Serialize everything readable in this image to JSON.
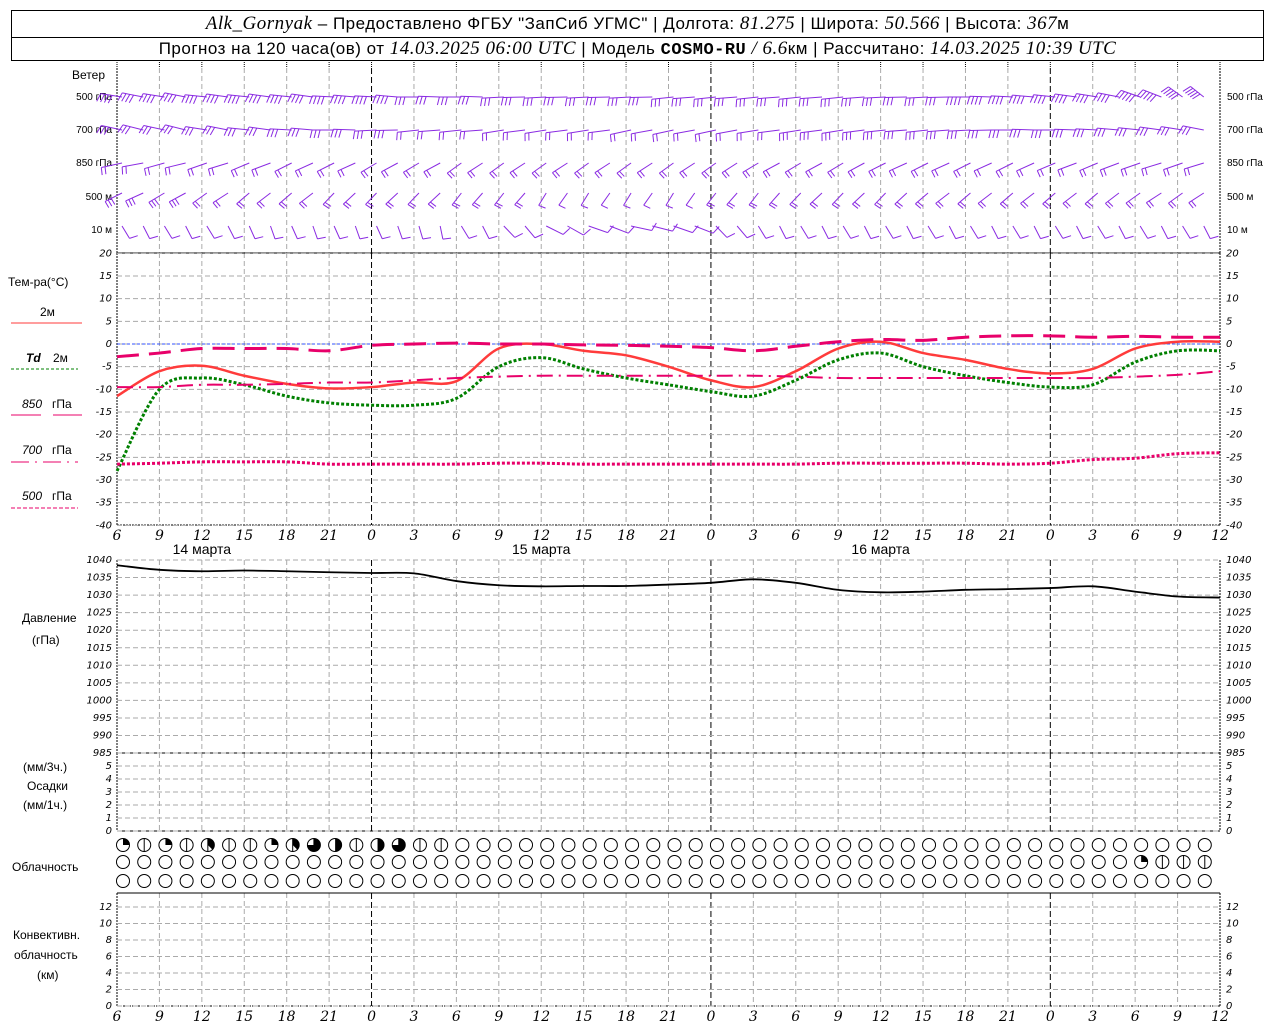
{
  "header": {
    "station": "Alk_Gornyak",
    "provided_by": " – Предоставлено ФГБУ \"ЗапСиб УГМС\" | Долгота: ",
    "longitude": "81.275",
    "lat_label": " | Широта: ",
    "latitude": "50.566",
    "alt_label": " | Высота: ",
    "altitude": "367",
    "alt_unit": "м",
    "forecast_prefix": "Прогноз на 120 часа(ов) от ",
    "forecast_start": "14.03.2025 06:00 UTC",
    "model_label": "  | Модель ",
    "model": "COSMO-RU",
    "resolution": " / 6.6",
    "res_unit": "км",
    "calc_label": " | Рассчитано: ",
    "calc_time": "14.03.2025 10:39 UTC"
  },
  "labels": {
    "wind": "Ветер",
    "wind_levels": [
      "500 гПа",
      "700 гПа",
      "850 гПа",
      "500  м",
      "10  м"
    ],
    "temp_title": "Тем-ра(°С)",
    "t2m": "2м",
    "td": "Td",
    "td2m": "2м",
    "l850": "850",
    "l700": "700",
    "l500": "500",
    "hpa": "гПа",
    "pressure": "Давление",
    "pressure_unit": "(гПа)",
    "precip_3h": "(мм/3ч.)",
    "precip": "Осадки",
    "precip_1h": "(мм/1ч.)",
    "clouds": "Облачность",
    "conv1": "Конвективн.",
    "conv2": "облачность",
    "conv3": "(км)"
  },
  "colors": {
    "wind": "#8a2be2",
    "t2m": "#ff3b3b",
    "td": "#008000",
    "t850": "#e8006a",
    "t700": "#e8006a",
    "t500": "#e8006a",
    "zero": "#3050ff",
    "grid": "#aaaaaa"
  },
  "chart_data": [
    {
      "type": "line",
      "title": "Тем-ра(°С)",
      "x_ticks": [
        "6",
        "9",
        "12",
        "15",
        "18",
        "21",
        "0",
        "3",
        "6",
        "9",
        "12",
        "15",
        "18",
        "21",
        "0",
        "3",
        "6",
        "9",
        "12",
        "15",
        "18",
        "21",
        "0",
        "3",
        "6",
        "9",
        "12"
      ],
      "dates": [
        "14 марта",
        "15 марта",
        "16 марта"
      ],
      "y_ticks": [
        "20",
        "15",
        "10",
        "5",
        "0",
        "-5",
        "-10",
        "-15",
        "-20",
        "-25",
        "-30",
        "-35",
        "-40"
      ],
      "ylim": [
        -40,
        20
      ],
      "grid": true,
      "series": [
        {
          "name": "2м",
          "key": "t2m",
          "values": [
            -11.5,
            -6,
            -4.8,
            -7,
            -8.8,
            -9.8,
            -9.5,
            -8.5,
            -8.2,
            -1,
            0,
            -1.5,
            -2.5,
            -5,
            -8,
            -9.5,
            -6,
            -1,
            0.5,
            -2,
            -3.5,
            -5.5,
            -6.5,
            -5.5,
            -1,
            0.5,
            0.5
          ]
        },
        {
          "name": "Td 2м",
          "key": "td",
          "values": [
            -28,
            -10,
            -7.5,
            -9,
            -11.5,
            -13,
            -13.5,
            -13.5,
            -12,
            -5,
            -3,
            -5.5,
            -7.5,
            -9,
            -10.5,
            -11.5,
            -8,
            -3.5,
            -2,
            -5,
            -7,
            -8.5,
            -9.5,
            -9,
            -4,
            -1.5,
            -1.5
          ]
        },
        {
          "name": "850 гПа",
          "key": "t850",
          "values": [
            -2.8,
            -2,
            -1,
            -1,
            -1,
            -1.5,
            -0.3,
            0,
            0.2,
            0,
            0,
            -0.2,
            -0.3,
            -0.5,
            -0.8,
            -1.5,
            -0.5,
            0.5,
            1,
            0.8,
            1.5,
            1.8,
            1.8,
            1.5,
            1.7,
            1.5,
            1.5
          ]
        },
        {
          "name": "700 гПа",
          "key": "t700",
          "values": [
            -9.5,
            -9.5,
            -9,
            -9,
            -8.8,
            -8.5,
            -8.5,
            -8,
            -7.5,
            -7.2,
            -7,
            -7,
            -7,
            -7,
            -7,
            -7,
            -7.2,
            -7.5,
            -7.5,
            -7.5,
            -7.5,
            -7.5,
            -7.5,
            -7.5,
            -7.2,
            -6.8,
            -6
          ]
        },
        {
          "name": "500 гПа",
          "key": "t500",
          "values": [
            -26.5,
            -26.3,
            -26,
            -26,
            -26,
            -26.5,
            -26.5,
            -26.5,
            -26.5,
            -26.3,
            -26.3,
            -26.5,
            -26.5,
            -26.5,
            -26.5,
            -26.5,
            -26.5,
            -26.3,
            -26.3,
            -26.3,
            -26.3,
            -26.5,
            -26.3,
            -25.5,
            -25.2,
            -24.2,
            -24
          ]
        }
      ]
    },
    {
      "type": "line",
      "title": "Давление (гПа)",
      "y_ticks": [
        "1040",
        "1035",
        "1030",
        "1025",
        "1020",
        "1015",
        "1010",
        "1005",
        "1000",
        "995",
        "990",
        "985"
      ],
      "ylim": [
        985,
        1040
      ],
      "series": [
        {
          "key": "pressure",
          "values": [
            1038.5,
            1037.2,
            1036.8,
            1037,
            1036.8,
            1036.5,
            1036.3,
            1036.2,
            1034,
            1032.8,
            1032.5,
            1032.6,
            1032.6,
            1033,
            1033.5,
            1034.5,
            1033.5,
            1031.5,
            1030.8,
            1031,
            1031.5,
            1031.7,
            1032,
            1032.5,
            1031,
            1029.6,
            1029.3
          ]
        }
      ]
    },
    {
      "type": "bar",
      "title": "Осадки",
      "y_ticks": [
        "0",
        "1",
        "2",
        "3",
        "4",
        "5"
      ],
      "ylim": [
        0,
        5.5
      ],
      "values": []
    },
    {
      "type": "table",
      "title": "Облачность",
      "rows_oktas": [
        [
          2,
          1,
          2,
          1,
          3,
          1,
          1,
          2,
          3,
          6,
          4,
          1,
          4,
          6,
          1,
          1,
          0,
          0,
          0,
          0,
          0,
          0,
          0,
          0,
          0,
          0,
          0,
          0,
          0,
          0,
          0,
          0,
          0,
          0,
          0,
          0,
          0,
          0,
          0,
          0,
          0,
          0,
          0,
          0,
          0,
          0,
          0,
          0,
          0,
          0,
          0,
          0
        ],
        [
          0,
          0,
          0,
          0,
          0,
          0,
          0,
          0,
          0,
          0,
          0,
          0,
          0,
          0,
          0,
          0,
          0,
          0,
          0,
          0,
          0,
          0,
          0,
          0,
          0,
          0,
          0,
          0,
          0,
          0,
          0,
          0,
          0,
          0,
          0,
          0,
          0,
          0,
          0,
          0,
          0,
          0,
          0,
          0,
          0,
          0,
          0,
          0,
          2,
          1,
          1,
          1
        ],
        [
          0,
          0,
          0,
          0,
          0,
          0,
          0,
          0,
          0,
          0,
          0,
          0,
          0,
          0,
          0,
          0,
          0,
          0,
          0,
          0,
          0,
          0,
          0,
          0,
          0,
          0,
          0,
          0,
          0,
          0,
          0,
          0,
          0,
          0,
          0,
          0,
          0,
          0,
          0,
          0,
          0,
          0,
          0,
          0,
          0,
          0,
          0,
          0,
          0,
          0,
          0,
          0
        ]
      ]
    },
    {
      "type": "bar",
      "title": "Конвективн. облачность (км)",
      "y_ticks": [
        "0",
        "2",
        "4",
        "6",
        "8",
        "10",
        "12"
      ],
      "ylim": [
        0,
        13.5
      ],
      "values": []
    },
    {
      "type": "wind_barbs",
      "levels": [
        {
          "name": "500 гПа",
          "dir": [
            285,
            285,
            280,
            280,
            280,
            275,
            275,
            270,
            270,
            265,
            265,
            265,
            265,
            260,
            260,
            260,
            260,
            260,
            265,
            265,
            270,
            275,
            280,
            285,
            300,
            320,
            330
          ],
          "speed": [
            40,
            40,
            40,
            40,
            35,
            35,
            35,
            30,
            30,
            30,
            30,
            30,
            30,
            30,
            30,
            30,
            30,
            30,
            30,
            30,
            35,
            35,
            40,
            40,
            45,
            45,
            45
          ]
        },
        {
          "name": "700 гПа",
          "dir": [
            290,
            290,
            285,
            280,
            275,
            270,
            265,
            260,
            260,
            255,
            255,
            255,
            250,
            250,
            250,
            255,
            255,
            255,
            260,
            260,
            265,
            270,
            270,
            275,
            280,
            285,
            290
          ],
          "speed": [
            30,
            30,
            30,
            25,
            25,
            25,
            25,
            20,
            20,
            20,
            20,
            20,
            20,
            20,
            20,
            20,
            25,
            25,
            25,
            25,
            30,
            30,
            30,
            30,
            30,
            30,
            30
          ]
        },
        {
          "name": "850 гПа",
          "dir": [
            250,
            245,
            240,
            235,
            230,
            230,
            225,
            225,
            220,
            220,
            220,
            220,
            220,
            220,
            220,
            225,
            225,
            225,
            230,
            230,
            230,
            230,
            235,
            235,
            240,
            240,
            240
          ],
          "speed": [
            20,
            20,
            20,
            20,
            20,
            20,
            20,
            20,
            15,
            15,
            15,
            15,
            15,
            15,
            20,
            20,
            20,
            20,
            20,
            20,
            20,
            20,
            20,
            20,
            20,
            20,
            20
          ]
        },
        {
          "name": "500  м",
          "dir": [
            230,
            225,
            220,
            215,
            215,
            210,
            210,
            210,
            205,
            205,
            200,
            200,
            200,
            200,
            205,
            205,
            210,
            210,
            210,
            215,
            215,
            215,
            215,
            215,
            220,
            220,
            220
          ],
          "speed": [
            25,
            25,
            20,
            20,
            20,
            20,
            20,
            20,
            15,
            15,
            10,
            10,
            10,
            10,
            15,
            15,
            20,
            20,
            20,
            20,
            20,
            20,
            20,
            20,
            20,
            20,
            20
          ]
        },
        {
          "name": "10  м",
          "dir": [
            160,
            160,
            160,
            165,
            165,
            165,
            165,
            170,
            160,
            150,
            130,
            120,
            110,
            120,
            150,
            160,
            160,
            160,
            160,
            160,
            160,
            160,
            160,
            160,
            160,
            160,
            160
          ],
          "speed": [
            10,
            10,
            10,
            10,
            10,
            10,
            10,
            10,
            5,
            5,
            5,
            5,
            5,
            5,
            5,
            10,
            10,
            10,
            10,
            10,
            10,
            10,
            10,
            10,
            10,
            10,
            10
          ]
        }
      ]
    }
  ]
}
